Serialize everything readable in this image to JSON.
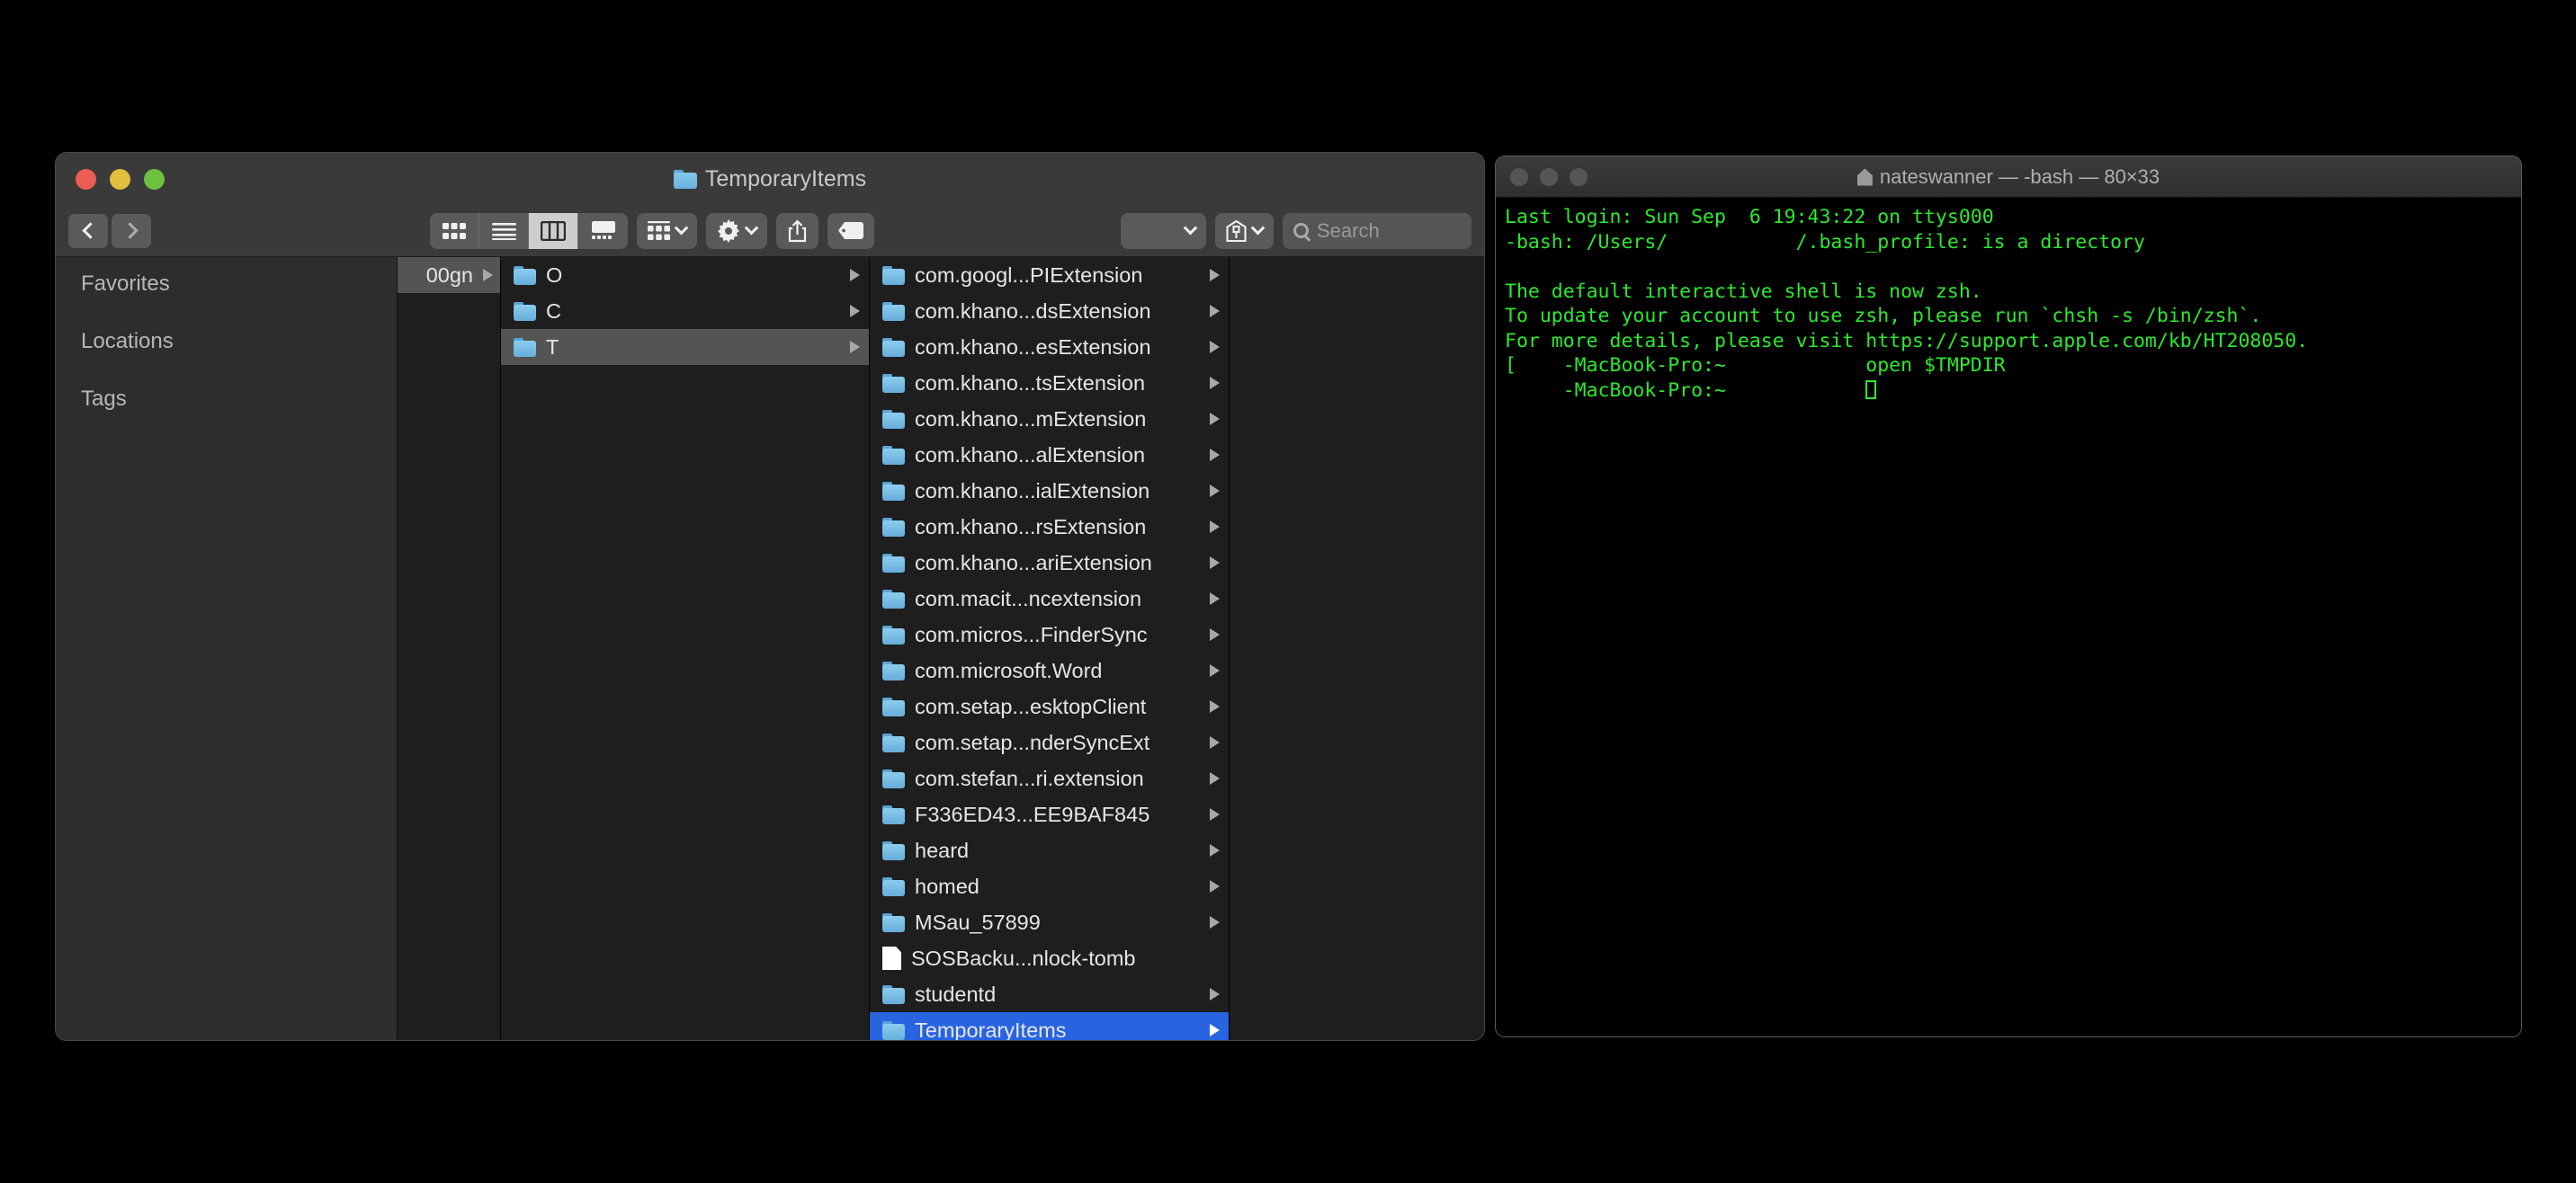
{
  "finder": {
    "window_title": "TemporaryItems",
    "nav": {
      "back_label": "Back",
      "forward_label": "Forward"
    },
    "view_modes": [
      {
        "name": "icon-view",
        "active": false
      },
      {
        "name": "list-view",
        "active": false
      },
      {
        "name": "column-view",
        "active": true
      },
      {
        "name": "gallery-view",
        "active": false
      }
    ],
    "toolbar": {
      "group_label": "Group",
      "action_label": "Action",
      "share_label": "Share",
      "tag_label": "Tags",
      "plugin_label": "Plugin",
      "dropbox_label": "Dropbox"
    },
    "search": {
      "placeholder": "Search",
      "value": ""
    },
    "sidebar": {
      "sections": [
        {
          "label": "Favorites"
        },
        {
          "label": "Locations"
        },
        {
          "label": "Tags"
        }
      ]
    },
    "columns": [
      {
        "name": "clipped-column",
        "items": [
          {
            "label": "00gn",
            "type": "folder",
            "selected": true,
            "has_children": true,
            "clipped": true
          }
        ]
      },
      {
        "name": "letters-column",
        "items": [
          {
            "label": "O",
            "type": "folder",
            "selected": false,
            "has_children": true
          },
          {
            "label": "C",
            "type": "folder",
            "selected": false,
            "has_children": true
          },
          {
            "label": "T",
            "type": "folder",
            "selected": true,
            "has_children": true
          }
        ]
      },
      {
        "name": "temporary-items-column",
        "items": [
          {
            "label": "com.googl...PIExtension",
            "type": "folder",
            "selected": false,
            "has_children": true
          },
          {
            "label": "com.khano...dsExtension",
            "type": "folder",
            "selected": false,
            "has_children": true
          },
          {
            "label": "com.khano...esExtension",
            "type": "folder",
            "selected": false,
            "has_children": true
          },
          {
            "label": "com.khano...tsExtension",
            "type": "folder",
            "selected": false,
            "has_children": true
          },
          {
            "label": "com.khano...mExtension",
            "type": "folder",
            "selected": false,
            "has_children": true
          },
          {
            "label": "com.khano...alExtension",
            "type": "folder",
            "selected": false,
            "has_children": true
          },
          {
            "label": "com.khano...ialExtension",
            "type": "folder",
            "selected": false,
            "has_children": true
          },
          {
            "label": "com.khano...rsExtension",
            "type": "folder",
            "selected": false,
            "has_children": true
          },
          {
            "label": "com.khano...ariExtension",
            "type": "folder",
            "selected": false,
            "has_children": true
          },
          {
            "label": "com.macit...ncextension",
            "type": "folder",
            "selected": false,
            "has_children": true
          },
          {
            "label": "com.micros...FinderSync",
            "type": "folder",
            "selected": false,
            "has_children": true
          },
          {
            "label": "com.microsoft.Word",
            "type": "folder",
            "selected": false,
            "has_children": true
          },
          {
            "label": "com.setap...esktopClient",
            "type": "folder",
            "selected": false,
            "has_children": true
          },
          {
            "label": "com.setap...nderSyncExt",
            "type": "folder",
            "selected": false,
            "has_children": true
          },
          {
            "label": "com.stefan...ri.extension",
            "type": "folder",
            "selected": false,
            "has_children": true
          },
          {
            "label": "F336ED43...EE9BAF845",
            "type": "folder",
            "selected": false,
            "has_children": true
          },
          {
            "label": "heard",
            "type": "folder",
            "selected": false,
            "has_children": true
          },
          {
            "label": "homed",
            "type": "folder",
            "selected": false,
            "has_children": true
          },
          {
            "label": "MSau_57899",
            "type": "folder",
            "selected": false,
            "has_children": true
          },
          {
            "label": "SOSBacku...nlock-tomb",
            "type": "document",
            "selected": false,
            "has_children": false
          },
          {
            "label": "studentd",
            "type": "folder",
            "selected": false,
            "has_children": true
          },
          {
            "label": "TemporaryItems",
            "type": "folder",
            "selected": true,
            "has_children": true
          }
        ]
      }
    ],
    "colors": {
      "selection_blue": "#2864e0",
      "selection_gray": "#545454",
      "folder_blue": "#8ccdee",
      "window_chrome": "#3a3a3a",
      "column_background": "#1e1e1e"
    }
  },
  "terminal": {
    "title": "nateswanner — -bash — 80×33",
    "lines": [
      "Last login: Sun Sep  6 19:43:22 on ttys000",
      "-bash: /Users/           /.bash_profile: is a directory",
      "",
      "The default interactive shell is now zsh.",
      "To update your account to use zsh, please run `chsh -s /bin/zsh`.",
      "For more details, please visit https://support.apple.com/kb/HT208050."
    ],
    "prompt_line": {
      "left_bracket": "[",
      "host": "-MacBook-Pro:~",
      "command": "open $TMPDIR",
      "right_bracket": "]"
    },
    "current_prompt": {
      "host": "-MacBook-Pro:~",
      "cursor": ""
    },
    "colors": {
      "text": "#2ee82e",
      "background": "#000000"
    }
  }
}
